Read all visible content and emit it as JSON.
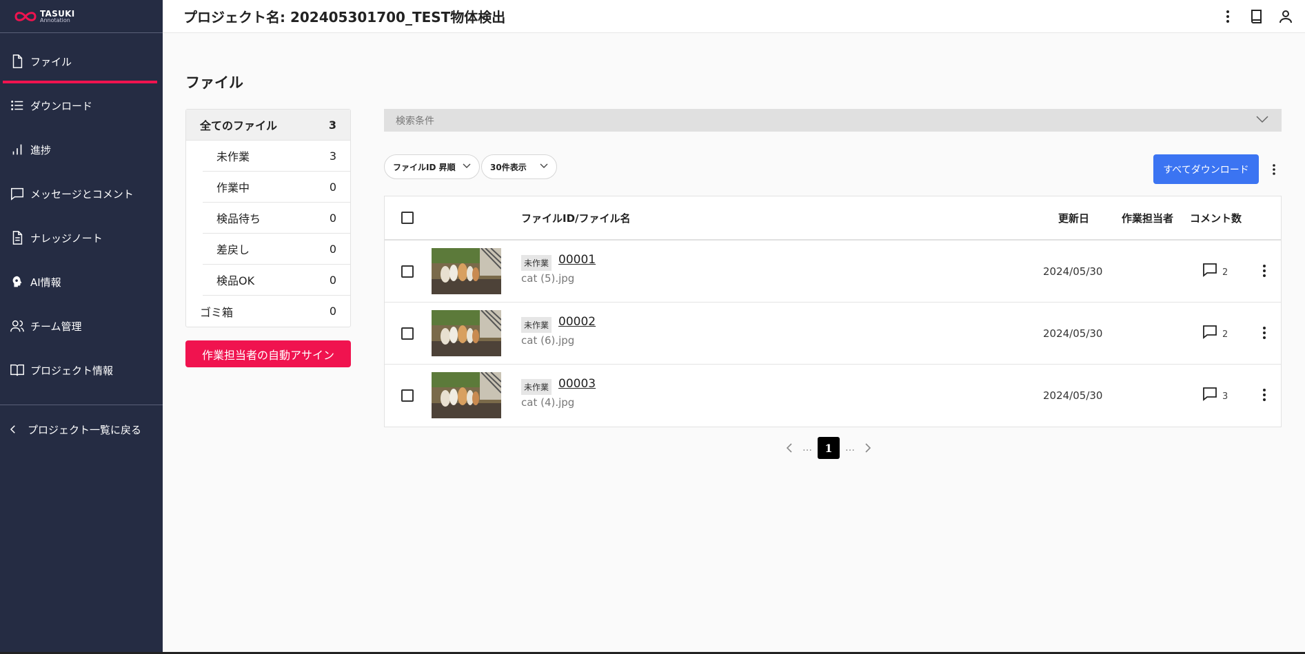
{
  "brand": {
    "name": "TASUKI",
    "sub": "Annotation"
  },
  "sidebar": {
    "items": [
      {
        "label": "ファイル",
        "icon": "file-icon",
        "active": true
      },
      {
        "label": "ダウンロード",
        "icon": "list-icon"
      },
      {
        "label": "進捗",
        "icon": "bar-chart-icon"
      },
      {
        "label": "メッセージとコメント",
        "icon": "chat-icon"
      },
      {
        "label": "ナレッジノート",
        "icon": "document-icon"
      },
      {
        "label": "AI情報",
        "icon": "ai-head-icon"
      },
      {
        "label": "チーム管理",
        "icon": "team-icon"
      },
      {
        "label": "プロジェクト情報",
        "icon": "book-icon"
      }
    ],
    "back_label": "プロジェクト一覧に戻る"
  },
  "header": {
    "title": "プロジェクト名: 202405301700_TEST物体検出"
  },
  "page": {
    "title": "ファイル"
  },
  "stats": {
    "all": {
      "label": "全てのファイル",
      "count": "3"
    },
    "sub": [
      {
        "label": "未作業",
        "count": "3"
      },
      {
        "label": "作業中",
        "count": "0"
      },
      {
        "label": "検品待ち",
        "count": "0"
      },
      {
        "label": "差戻し",
        "count": "0"
      },
      {
        "label": "検品OK",
        "count": "0"
      }
    ],
    "trash": {
      "label": "ゴミ箱",
      "count": "0"
    }
  },
  "assign_button": "作業担当者の自動アサイン",
  "search": {
    "label": "検索条件"
  },
  "sort_select": "ファイルID 昇順",
  "per_page_select": "30件表示",
  "download_all": "すべてダウンロード",
  "table": {
    "headers": {
      "file": "ファイルID/ファイル名",
      "updated": "更新日",
      "assignee": "作業担当者",
      "comments": "コメント数"
    },
    "rows": [
      {
        "status": "未作業",
        "id": "00001",
        "name": "cat (5).jpg",
        "date": "2024/05/30",
        "comments": "2"
      },
      {
        "status": "未作業",
        "id": "00002",
        "name": "cat (6).jpg",
        "date": "2024/05/30",
        "comments": "2"
      },
      {
        "status": "未作業",
        "id": "00003",
        "name": "cat (4).jpg",
        "date": "2024/05/30",
        "comments": "3"
      }
    ]
  },
  "pagination": {
    "current": "1",
    "dots": "…"
  },
  "colors": {
    "sidebar": "#252c43",
    "accent": "#f0134f",
    "primary": "#3b74f2"
  }
}
